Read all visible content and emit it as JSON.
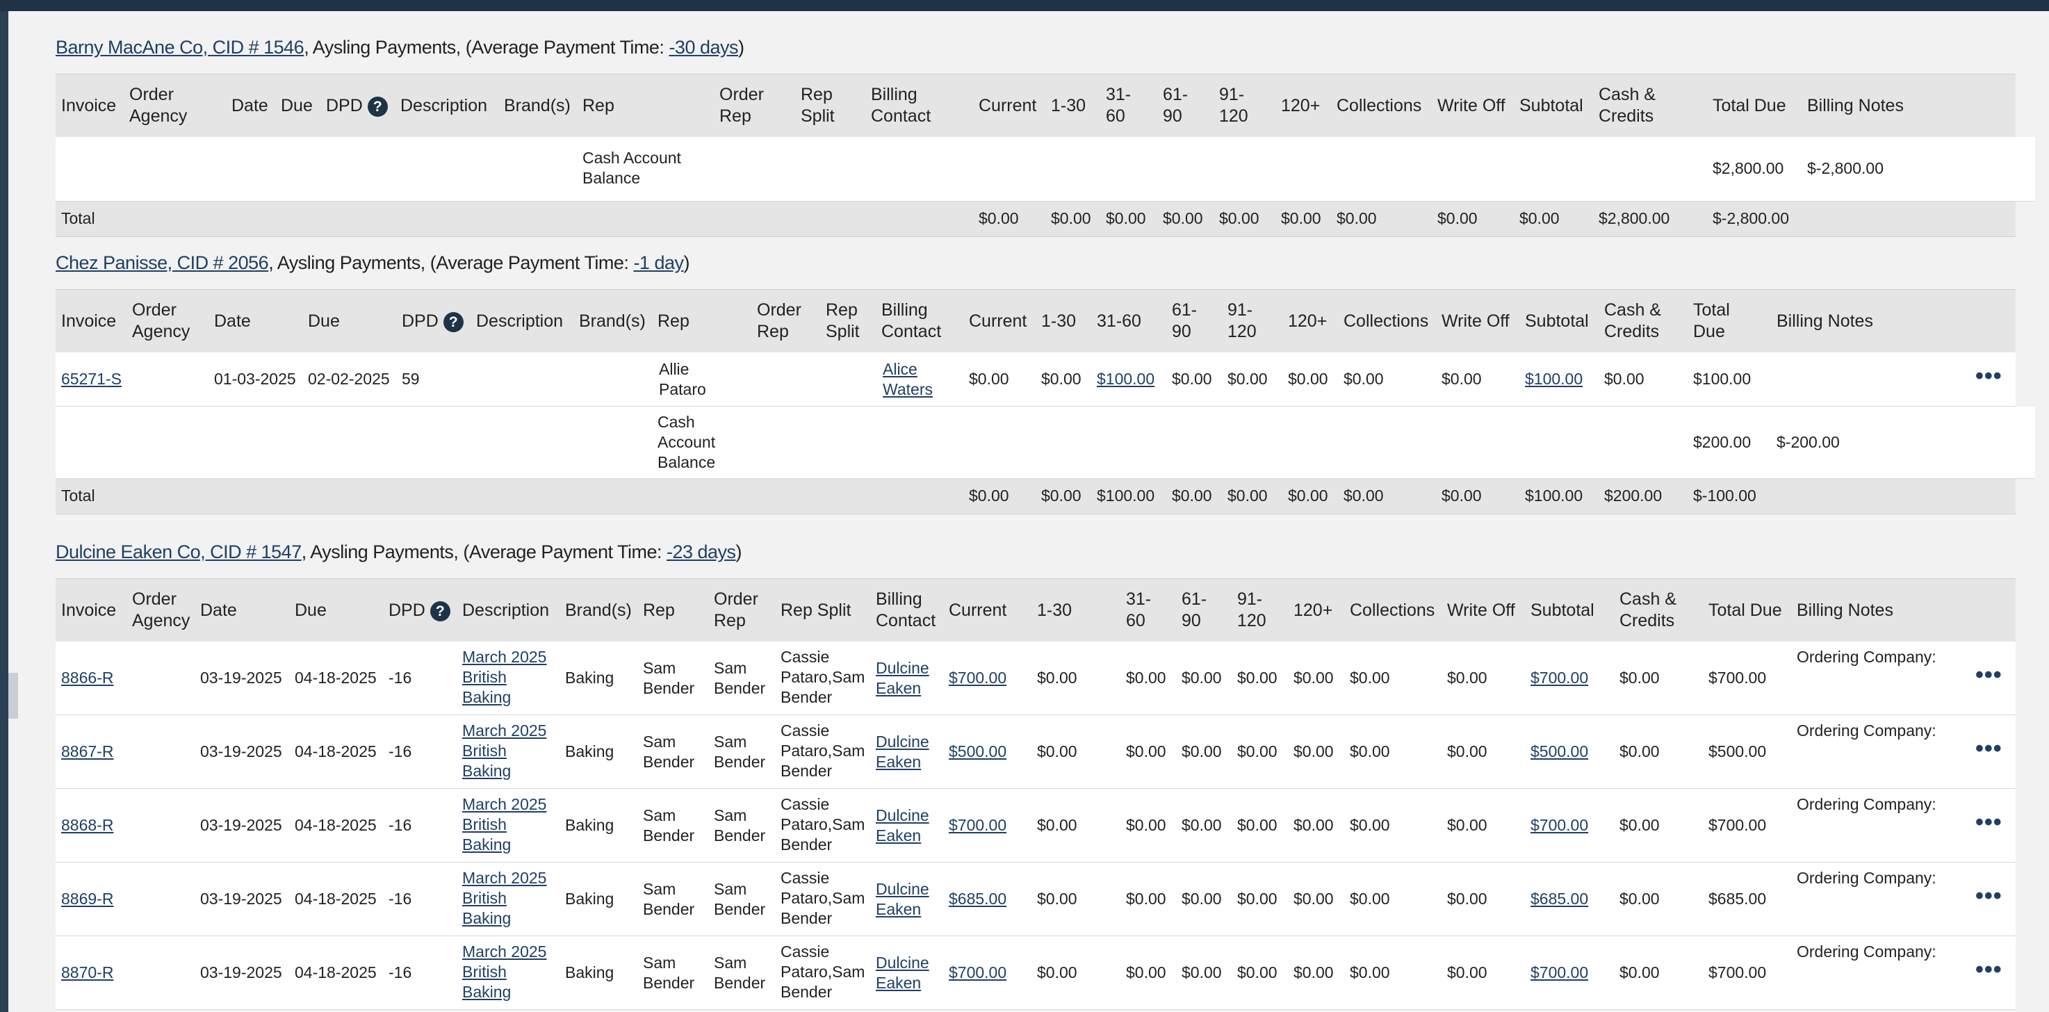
{
  "sections": [
    {
      "customer_link": "Barny MacAne Co, CID # 1546",
      "title_middle": ", Aysling Payments, (Average Payment Time: ",
      "avg_link": "-30 days",
      "title_end": ")",
      "headers": {
        "invoice": "Invoice",
        "order_agency": "Order Agency",
        "date": "Date",
        "due": "Due",
        "dpd": "DPD",
        "description": "Description",
        "brands": "Brand(s)",
        "rep": "Rep",
        "order_rep": "Order Rep",
        "rep_split": "Rep Split",
        "billing_contact": "Billing Contact",
        "current": "Current",
        "b1_30": "1-30",
        "b31_60": "31-60",
        "b61_90": "61-90",
        "b91_120": "91-120",
        "b120": "120+",
        "collections": "Collections",
        "write_off": "Write Off",
        "subtotal": "Subtotal",
        "cash_credits": "Cash & Credits",
        "total_due": "Total Due",
        "billing_notes": "Billing Notes"
      },
      "cash_row": {
        "label": "Cash Account Balance",
        "cash": "$2,800.00",
        "total": "$-2,800.00"
      },
      "total": {
        "label": "Total",
        "current": "$0.00",
        "b1_30": "$0.00",
        "b31_60": "$0.00",
        "b61_90": "$0.00",
        "b91_120": "$0.00",
        "b120": "$0.00",
        "collections": "$0.00",
        "write_off": "$0.00",
        "subtotal": "$0.00",
        "cash_credits": "$2,800.00",
        "total_due": "$-2,800.00"
      }
    },
    {
      "customer_link": "Chez Panisse, CID # 2056",
      "title_middle": ", Aysling Payments, (Average Payment Time: ",
      "avg_link": "-1 day",
      "title_end": ")",
      "headers": {
        "invoice": "Invoice",
        "order_agency": "Order Agency",
        "date": "Date",
        "due": "Due",
        "dpd": "DPD",
        "description": "Description",
        "brands": "Brand(s)",
        "rep": "Rep",
        "order_rep": "Order Rep",
        "rep_split": "Rep Split",
        "billing_contact": "Billing Contact",
        "current": "Current",
        "b1_30": "1-30",
        "b31_60": "31-60",
        "b61_90": "61-90",
        "b91_120": "91-120",
        "b120": "120+",
        "collections": "Collections",
        "write_off": "Write Off",
        "subtotal": "Subtotal",
        "cash_credits": "Cash & Credits",
        "total_due": "Total Due",
        "billing_notes": "Billing Notes"
      },
      "rows": [
        {
          "invoice": "65271-S",
          "date": "01-03-2025",
          "due": "02-02-2025",
          "dpd": "59",
          "rep": "Allie Pataro",
          "billing_contact": "Alice Waters",
          "current": "$0.00",
          "b1_30": "$0.00",
          "b31_60": "$100.00",
          "b61_90": "$0.00",
          "b91_120": "$0.00",
          "b120": "$0.00",
          "collections": "$0.00",
          "write_off": "$0.00",
          "subtotal": "$100.00",
          "cash_credits": "$0.00",
          "total_due": "$100.00"
        }
      ],
      "cash_row": {
        "label": "Cash Account Balance",
        "cash": "$200.00",
        "total": "$-200.00"
      },
      "total": {
        "label": "Total",
        "current": "$0.00",
        "b1_30": "$0.00",
        "b31_60": "$100.00",
        "b61_90": "$0.00",
        "b91_120": "$0.00",
        "b120": "$0.00",
        "collections": "$0.00",
        "write_off": "$0.00",
        "subtotal": "$100.00",
        "cash_credits": "$200.00",
        "total_due": "$-100.00"
      }
    },
    {
      "customer_link": "Dulcine Eaken Co, CID # 1547",
      "title_middle": ", Aysling Payments, (Average Payment Time: ",
      "avg_link": "-23 days",
      "title_end": ")",
      "headers": {
        "invoice": "Invoice",
        "order_agency": "Order Agency",
        "date": "Date",
        "due": "Due",
        "dpd": "DPD",
        "description": "Description",
        "brands": "Brand(s)",
        "rep": "Rep",
        "order_rep": "Order Rep",
        "rep_split": "Rep Split",
        "billing_contact": "Billing Contact",
        "current": "Current",
        "b1_30": "1-30",
        "b31_60": "31-60",
        "b61_90": "61-90",
        "b91_120": "91-120",
        "b120": "120+",
        "collections": "Collections",
        "write_off": "Write Off",
        "subtotal": "Subtotal",
        "cash_credits": "Cash & Credits",
        "total_due": "Total Due",
        "billing_notes": "Billing Notes"
      },
      "rows": [
        {
          "invoice": "8866-R",
          "date": "03-19-2025",
          "due": "04-18-2025",
          "dpd": "-16",
          "description": "March 2025 British Baking",
          "brands": "Baking",
          "rep": "Sam Bender",
          "order_rep": "Sam Bender",
          "rep_split": "Cassie Pataro,Sam Bender",
          "billing_contact": "Dulcine Eaken",
          "current": "$700.00",
          "b1_30": "$0.00",
          "b31_60": "$0.00",
          "b61_90": "$0.00",
          "b91_120": "$0.00",
          "b120": "$0.00",
          "collections": "$0.00",
          "write_off": "$0.00",
          "subtotal": "$700.00",
          "cash_credits": "$0.00",
          "total_due": "$700.00",
          "billing_notes": "Ordering Company:"
        },
        {
          "invoice": "8867-R",
          "date": "03-19-2025",
          "due": "04-18-2025",
          "dpd": "-16",
          "description": "March 2025 British Baking",
          "brands": "Baking",
          "rep": "Sam Bender",
          "order_rep": "Sam Bender",
          "rep_split": "Cassie Pataro,Sam Bender",
          "billing_contact": "Dulcine Eaken",
          "current": "$500.00",
          "b1_30": "$0.00",
          "b31_60": "$0.00",
          "b61_90": "$0.00",
          "b91_120": "$0.00",
          "b120": "$0.00",
          "collections": "$0.00",
          "write_off": "$0.00",
          "subtotal": "$500.00",
          "cash_credits": "$0.00",
          "total_due": "$500.00",
          "billing_notes": "Ordering Company:"
        },
        {
          "invoice": "8868-R",
          "date": "03-19-2025",
          "due": "04-18-2025",
          "dpd": "-16",
          "description": "March 2025 British Baking",
          "brands": "Baking",
          "rep": "Sam Bender",
          "order_rep": "Sam Bender",
          "rep_split": "Cassie Pataro,Sam Bender",
          "billing_contact": "Dulcine Eaken",
          "current": "$700.00",
          "b1_30": "$0.00",
          "b31_60": "$0.00",
          "b61_90": "$0.00",
          "b91_120": "$0.00",
          "b120": "$0.00",
          "collections": "$0.00",
          "write_off": "$0.00",
          "subtotal": "$700.00",
          "cash_credits": "$0.00",
          "total_due": "$700.00",
          "billing_notes": "Ordering Company:"
        },
        {
          "invoice": "8869-R",
          "date": "03-19-2025",
          "due": "04-18-2025",
          "dpd": "-16",
          "description": "March 2025 British Baking",
          "brands": "Baking",
          "rep": "Sam Bender",
          "order_rep": "Sam Bender",
          "rep_split": "Cassie Pataro,Sam Bender",
          "billing_contact": "Dulcine Eaken",
          "current": "$685.00",
          "b1_30": "$0.00",
          "b31_60": "$0.00",
          "b61_90": "$0.00",
          "b91_120": "$0.00",
          "b120": "$0.00",
          "collections": "$0.00",
          "write_off": "$0.00",
          "subtotal": "$685.00",
          "cash_credits": "$0.00",
          "total_due": "$685.00",
          "billing_notes": "Ordering Company:"
        },
        {
          "invoice": "8870-R",
          "date": "03-19-2025",
          "due": "04-18-2025",
          "dpd": "-16",
          "description": "March 2025 British Baking",
          "brands": "Baking",
          "rep": "Sam Bender",
          "order_rep": "Sam Bender",
          "rep_split": "Cassie Pataro,Sam Bender",
          "billing_contact": "Dulcine Eaken",
          "current": "$700.00",
          "b1_30": "$0.00",
          "b31_60": "$0.00",
          "b61_90": "$0.00",
          "b91_120": "$0.00",
          "b120": "$0.00",
          "collections": "$0.00",
          "write_off": "$0.00",
          "subtotal": "$700.00",
          "cash_credits": "$0.00",
          "total_due": "$700.00",
          "billing_notes": "Ordering Company:"
        }
      ]
    }
  ],
  "icons": {
    "help": "?",
    "more": "•••"
  }
}
